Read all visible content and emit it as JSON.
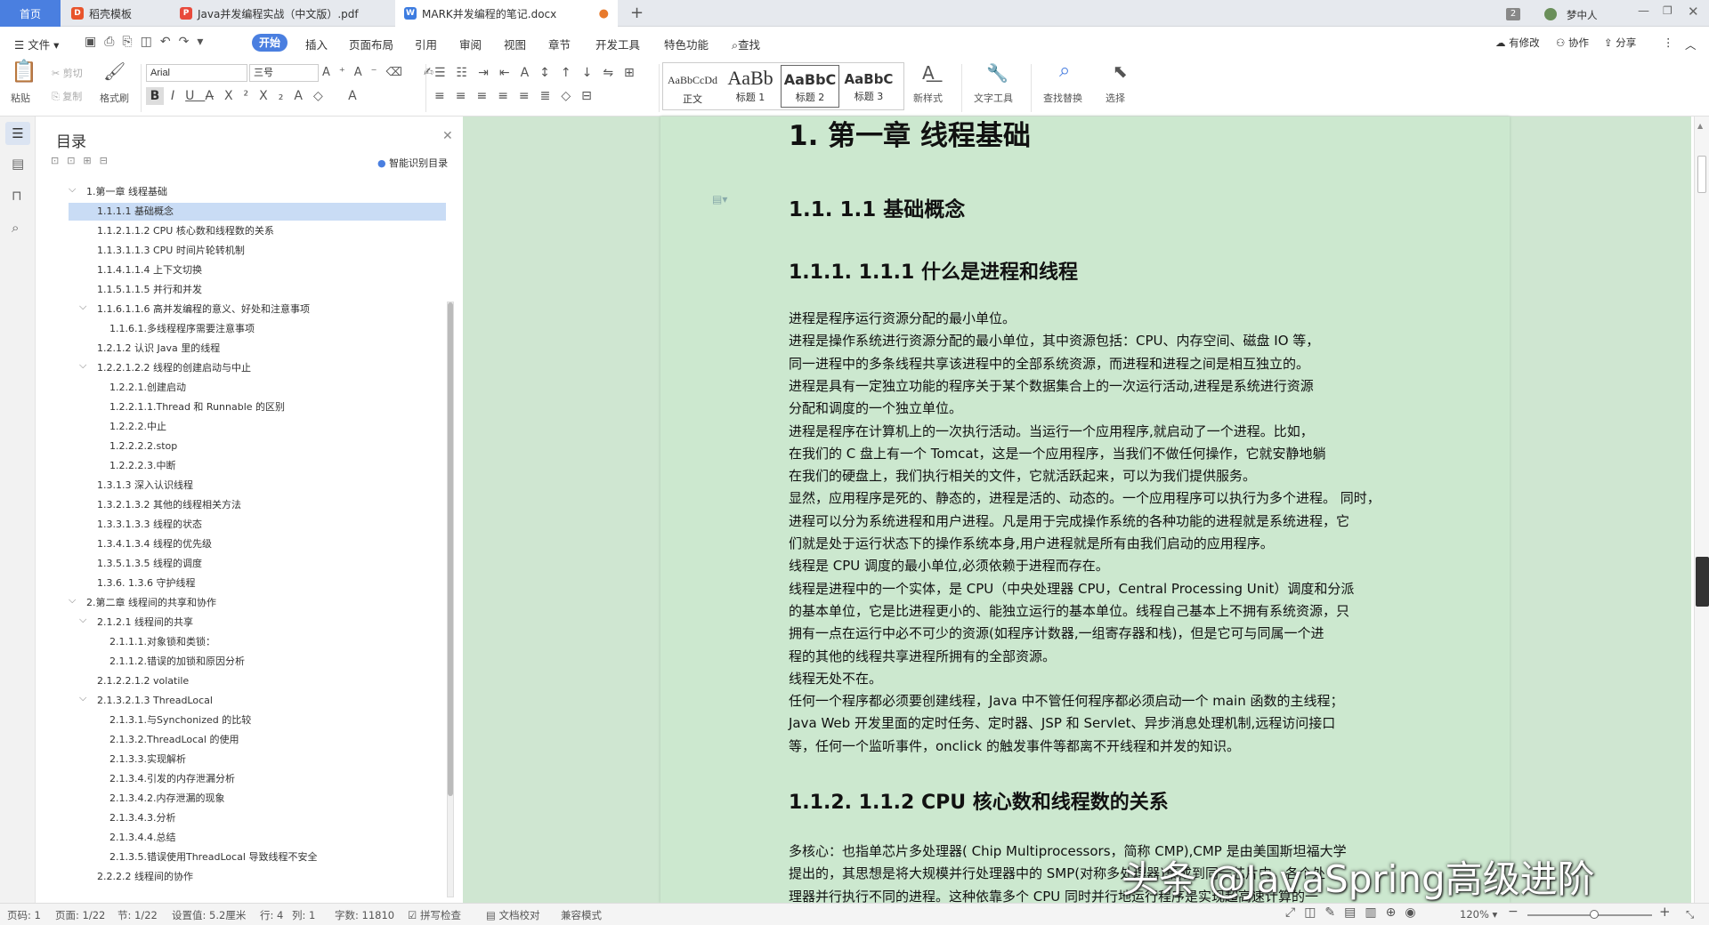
{
  "tabs": [
    {
      "label": "首页"
    },
    {
      "label": "稻壳模板"
    },
    {
      "label": "Java并发编程实战（中文版）.pdf"
    },
    {
      "label": "MARK并发编程的笔记.docx"
    }
  ],
  "window": {
    "badge": "2",
    "user": "梦中人"
  },
  "menu": {
    "file": "文件",
    "items": [
      "开始",
      "插入",
      "页面布局",
      "引用",
      "审阅",
      "视图",
      "章节",
      "开发工具",
      "特色功能"
    ],
    "search": "查找",
    "right": [
      "有修改",
      "协作",
      "分享"
    ]
  },
  "ribbon": {
    "paste": "粘贴",
    "cut": "剪切",
    "copy": "复制",
    "format_painter": "格式刷",
    "font": "Arial",
    "size": "三号",
    "styles": [
      {
        "preview": "AaBbCcDd",
        "name": "正文"
      },
      {
        "preview": "AaBb",
        "name": "标题 1"
      },
      {
        "preview": "AaBbC",
        "name": "标题 2"
      },
      {
        "preview": "AaBbC",
        "name": "标题 3"
      }
    ],
    "new_style": "新样式",
    "text_tools": "文字工具",
    "find_replace": "查找替换",
    "select": "选择"
  },
  "toc": {
    "title": "目录",
    "smart": "智能识别目录",
    "items": [
      {
        "label": "1.第一章 线程基础"
      },
      {
        "label": "1.1.1.1 基础概念"
      },
      {
        "label": "1.1.2.1.1.2 CPU 核心数和线程数的关系"
      },
      {
        "label": "1.1.3.1.1.3 CPU 时间片轮转机制"
      },
      {
        "label": "1.1.4.1.1.4 上下文切换"
      },
      {
        "label": "1.1.5.1.1.5 并行和并发"
      },
      {
        "label": "1.1.6.1.1.6 高并发编程的意义、好处和注意事项"
      },
      {
        "label": "1.1.6.1.多线程程序需要注意事项"
      },
      {
        "label": "1.2.1.2 认识 Java 里的线程"
      },
      {
        "label": "1.2.2.1.2.2 线程的创建启动与中止"
      },
      {
        "label": "1.2.2.1.创建启动"
      },
      {
        "label": "1.2.2.1.1.Thread 和 Runnable 的区别"
      },
      {
        "label": "1.2.2.2.中止"
      },
      {
        "label": "1.2.2.2.2.stop"
      },
      {
        "label": "1.2.2.2.3.中断"
      },
      {
        "label": "1.3.1.3 深入认识线程"
      },
      {
        "label": "1.3.2.1.3.2 其他的线程相关方法"
      },
      {
        "label": "1.3.3.1.3.3 线程的状态"
      },
      {
        "label": "1.3.4.1.3.4 线程的优先级"
      },
      {
        "label": "1.3.5.1.3.5 线程的调度"
      },
      {
        "label": "1.3.6. 1.3.6 守护线程"
      },
      {
        "label": "2.第二章 线程间的共享和协作"
      },
      {
        "label": "2.1.2.1 线程间的共享"
      },
      {
        "label": "2.1.1.1.对象锁和类锁："
      },
      {
        "label": "2.1.1.2.错误的加锁和原因分析"
      },
      {
        "label": "2.1.2.2.1.2 volatile"
      },
      {
        "label": "2.1.3.2.1.3 ThreadLocal"
      },
      {
        "label": "2.1.3.1.与Synchonized 的比较"
      },
      {
        "label": "2.1.3.2.ThreadLocal 的使用"
      },
      {
        "label": "2.1.3.3.实现解析"
      },
      {
        "label": "2.1.3.4.引发的内存泄漏分析"
      },
      {
        "label": "2.1.3.4.2.内存泄漏的现象"
      },
      {
        "label": "2.1.3.4.3.分析"
      },
      {
        "label": "2.1.3.4.4.总结"
      },
      {
        "label": "2.1.3.5.错误使用ThreadLocal 导致线程不安全"
      },
      {
        "label": "2.2.2.2 线程间的协作"
      }
    ]
  },
  "doc": {
    "h1": "1. 第一章  线程基础",
    "h2": "1.1. 1.1 基础概念",
    "h3a": "1.1.1.  1.1.1 什么是进程和线程",
    "lines": [
      "进程是程序运行资源分配的最小单位。",
      "进程是操作系统进行资源分配的最小单位，其中资源包括：CPU、内存空间、磁盘  IO 等，",
      "同一进程中的多条线程共享该进程中的全部系统资源，而进程和进程之间是相互独立的。",
      "进程是具有一定独立功能的程序关于某个数据集合上的一次运行活动,进程是系统进行资源",
      "分配和调度的一个独立单位。",
      "进程是程序在计算机上的一次执行活动。当运行一个应用程序,就启动了一个进程。比如，",
      "在我们的  C 盘上有一个  Tomcat，这是一个应用程序，当我们不做任何操作，它就安静地躺",
      "在我们的硬盘上，我们执行相关的文件，它就活跃起来，可以为我们提供服务。",
      "显然，应用程序是死的、静态的，进程是活的、动态的。一个应用程序可以执行为多个进程。      同时，",
      "进程可以分为系统进程和用户进程。凡是用于完成操作系统的各种功能的进程就是系统进程，它",
      "们就是处于运行状态下的操作系统本身,用户进程就是所有由我们启动的应用程序。",
      "线程是  CPU 调度的最小单位,必须依赖于进程而存在。",
      "线程是进程中的一个实体，是  CPU（中央处理器  CPU，Central Processing Unit）调度和分派",
      "的基本单位，它是比进程更小的、能独立运行的基本单位。线程自己基本上不拥有系统资源，只",
      "拥有一点在运行中必不可少的资源(如程序计数器,一组寄存器和栈)，但是它可与同属一个进",
      "程的其他的线程共享进程所拥有的全部资源。",
      "线程无处不在。",
      "任何一个程序都必须要创建线程，Java 中不管任何程序都必须启动一个  main 函数的主线程；",
      "Java Web 开发里面的定时任务、定时器、JSP 和  Servlet、异步消息处理机制,远程访问接口",
      "等，任何一个监听事件，onclick 的触发事件等都离不开线程和并发的知识。"
    ],
    "h3b": "1.1.2.  1.1.2 CPU 核心数和线程数的关系",
    "lines2": [
      "多核心：也指单芯片多处理器( Chip Multiprocessors，简称  CMP),CMP 是由美国斯坦福大学",
      "提出的，其思想是将大规模并行处理器中的  SMP(对称多处理器)集成到同一芯片内，各个处",
      "理器并行执行不同的进程。这种依靠多个  CPU 同时并行地运行程序是实现超高速计算的一"
    ]
  },
  "status": {
    "page": "页码: 1",
    "pages": "页面: 1/22",
    "section": "节: 1/22",
    "setting": "设置值: 5.2厘米",
    "row": "行: 4",
    "col": "列: 1",
    "words": "字数: 11810",
    "spell": "拼写检查",
    "proof": "文档校对",
    "compat": "兼容模式",
    "zoom": "120%"
  },
  "watermark": "头条 @JavaSpring高级进阶",
  "colors": {
    "accent": "#4a7fe0",
    "page_bg": "#cce8cf",
    "doc_bg": "#cfe6d1",
    "toc_selected": "#c9dcf5"
  }
}
